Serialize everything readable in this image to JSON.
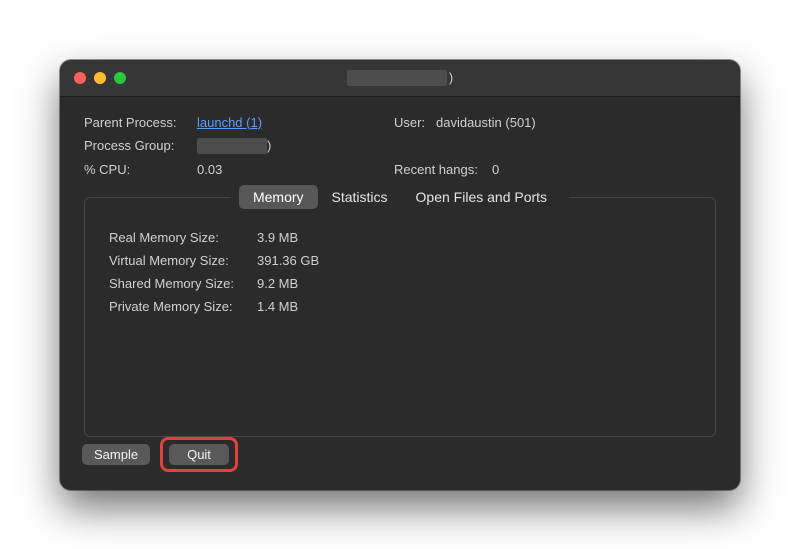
{
  "titlebar": {
    "title_suffix": ")"
  },
  "info": {
    "parent_process_label": "Parent Process:",
    "parent_process_link": "launchd (1)",
    "process_group_label": "Process Group:",
    "process_group_suffix": ")",
    "cpu_label": "% CPU:",
    "cpu_value": "0.03",
    "user_label": "User:",
    "user_value": "davidaustin (501)",
    "recent_hangs_label": "Recent hangs:",
    "recent_hangs_value": "0"
  },
  "tabs": {
    "memory": "Memory",
    "statistics": "Statistics",
    "open_files": "Open Files and Ports"
  },
  "memory": {
    "rows": [
      {
        "label": "Real Memory Size:",
        "value": "3.9 MB"
      },
      {
        "label": "Virtual Memory Size:",
        "value": "391.36 GB"
      },
      {
        "label": "Shared Memory Size:",
        "value": "9.2 MB"
      },
      {
        "label": "Private Memory Size:",
        "value": "1.4 MB"
      }
    ]
  },
  "buttons": {
    "sample": "Sample",
    "quit": "Quit"
  }
}
